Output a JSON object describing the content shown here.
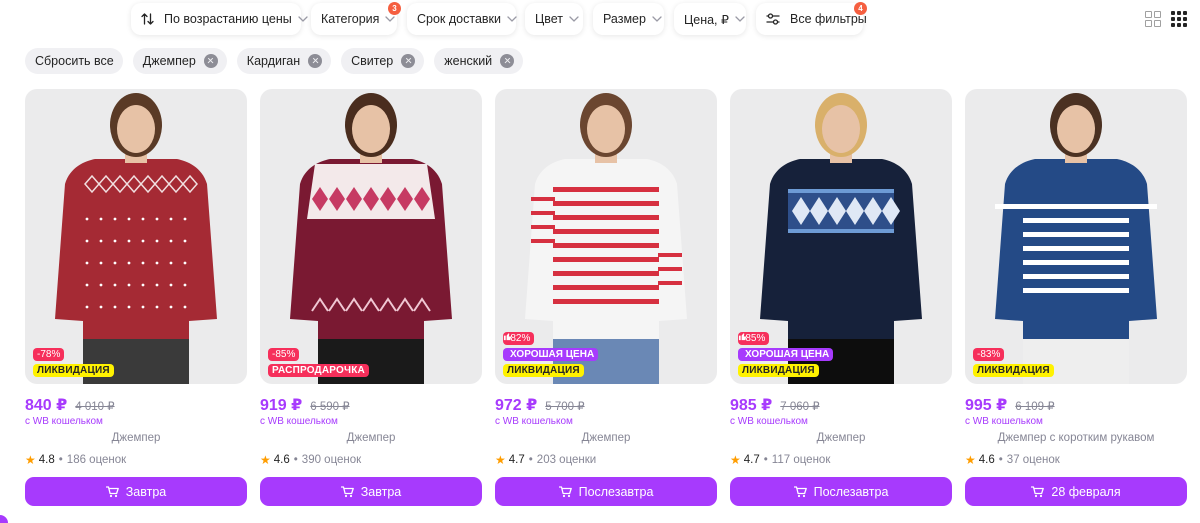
{
  "filters": {
    "sort": {
      "label": "По возрастанию цены"
    },
    "category": {
      "label": "Категория",
      "badge": "3"
    },
    "delivery": {
      "label": "Срок доставки"
    },
    "color": {
      "label": "Цвет"
    },
    "size": {
      "label": "Размер"
    },
    "price": {
      "label": "Цена, ₽"
    },
    "all": {
      "label": "Все фильтры",
      "badge": "4"
    }
  },
  "chips": {
    "reset": "Сбросить все",
    "items": [
      "Джемпер",
      "Кардиган",
      "Свитер",
      "женский"
    ]
  },
  "products": [
    {
      "price": "840 ₽",
      "old_price": "4 010 ₽",
      "wallet": "с WB кошельком",
      "name": "Джемпер",
      "rating": "4.8",
      "reviews": "186 оценок",
      "discount": "-78%",
      "badges": [
        "ЛИКВИДАЦИЯ"
      ],
      "delivery": "Завтра",
      "sweater_color": "#a52a34"
    },
    {
      "price": "919 ₽",
      "old_price": "6 590 ₽",
      "wallet": "с WB кошельком",
      "name": "Джемпер",
      "rating": "4.6",
      "reviews": "390 оценок",
      "discount": "-85%",
      "badges": [
        "РАСПРОДАРОЧКА"
      ],
      "delivery": "Завтра",
      "sweater_color": "#7a1932"
    },
    {
      "price": "972 ₽",
      "old_price": "5 700 ₽",
      "wallet": "с WB кошельком",
      "name": "Джемпер",
      "rating": "4.7",
      "reviews": "203 оценки",
      "discount": "-82%",
      "badges": [
        "ХОРОШАЯ ЦЕНА",
        "ЛИКВИДАЦИЯ"
      ],
      "delivery": "Послезавтра",
      "sweater_color": "#f5f5f5"
    },
    {
      "price": "985 ₽",
      "old_price": "7 060 ₽",
      "wallet": "с WB кошельком",
      "name": "Джемпер",
      "rating": "4.7",
      "reviews": "117 оценок",
      "discount": "-85%",
      "badges": [
        "ХОРОШАЯ ЦЕНА",
        "ЛИКВИДАЦИЯ"
      ],
      "delivery": "Послезавтра",
      "sweater_color": "#16213a"
    },
    {
      "price": "995 ₽",
      "old_price": "6 109 ₽",
      "wallet": "с WB кошельком",
      "name": "Джемпер с коротким рукавом",
      "rating": "4.6",
      "reviews": "37 оценок",
      "discount": "-83%",
      "badges": [
        "ЛИКВИДАЦИЯ"
      ],
      "delivery": "28 февраля",
      "sweater_color": "#244a86"
    }
  ],
  "colors": {
    "accent": "#a73afd",
    "discount": "#f62f5b",
    "liquidation": "#fff200",
    "badge": "#f55f40"
  }
}
